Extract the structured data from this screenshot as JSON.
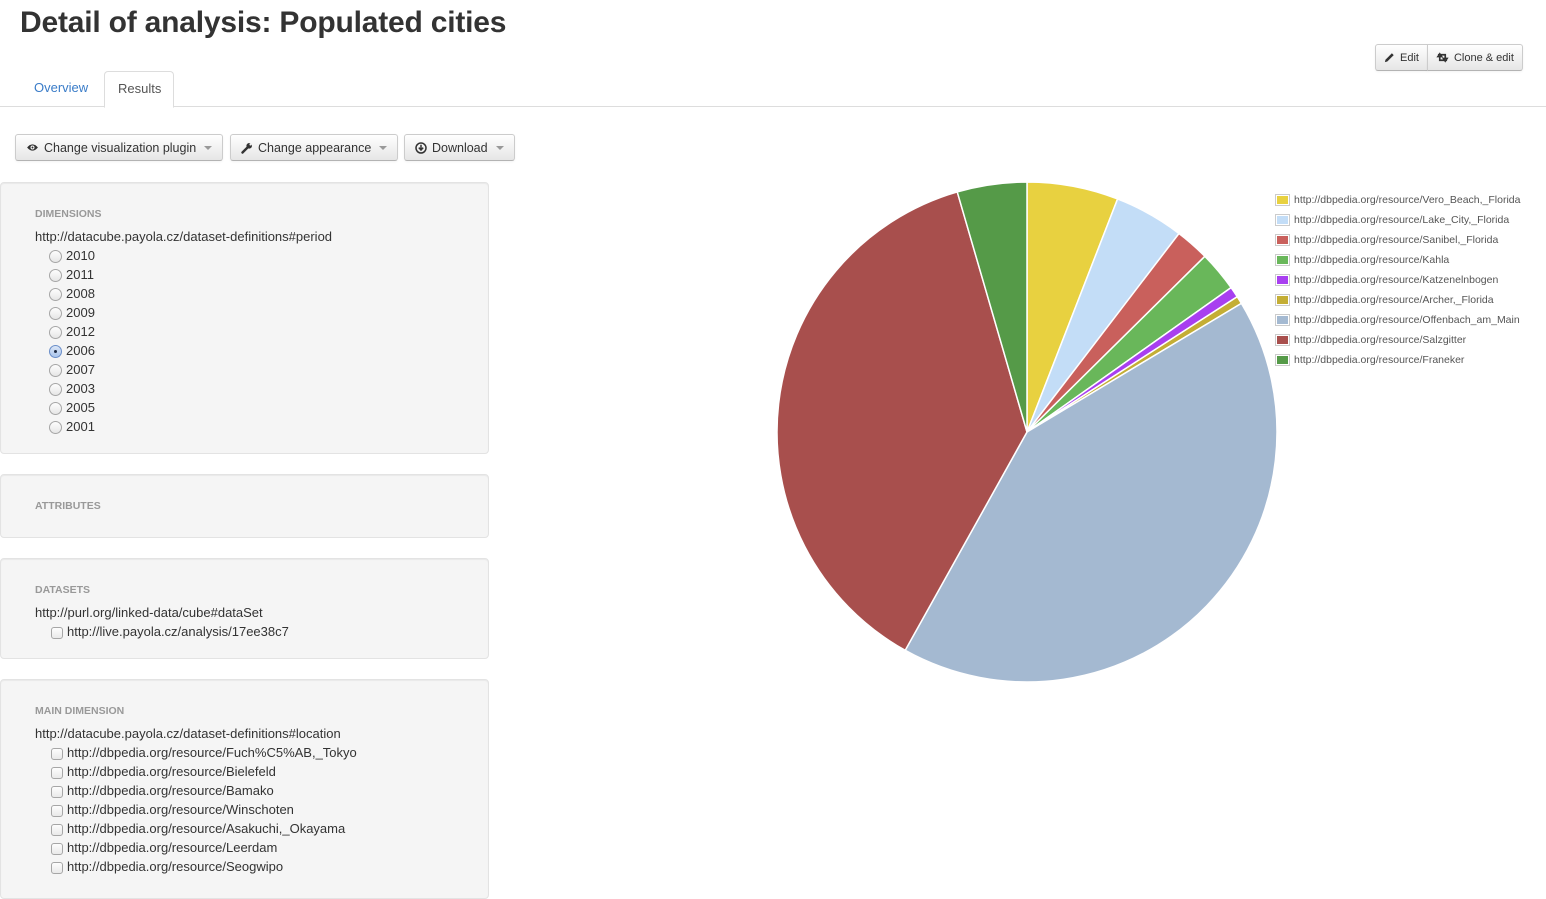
{
  "page": {
    "title": "Detail of analysis: Populated cities"
  },
  "actions": {
    "edit_label": "Edit",
    "clone_label": "Clone & edit"
  },
  "tabs": [
    {
      "label": "Overview",
      "active": false
    },
    {
      "label": "Results",
      "active": true
    }
  ],
  "toolbar": {
    "plugin_label": "Change visualization plugin",
    "appearance_label": "Change appearance",
    "download_label": "Download"
  },
  "dimensions": {
    "heading": "DIMENSIONS",
    "uri": "http://datacube.payola.cz/dataset-definitions#period",
    "options": [
      {
        "label": "2010",
        "checked": false
      },
      {
        "label": "2011",
        "checked": false
      },
      {
        "label": "2008",
        "checked": false
      },
      {
        "label": "2009",
        "checked": false
      },
      {
        "label": "2012",
        "checked": false
      },
      {
        "label": "2006",
        "checked": true
      },
      {
        "label": "2007",
        "checked": false
      },
      {
        "label": "2003",
        "checked": false
      },
      {
        "label": "2005",
        "checked": false
      },
      {
        "label": "2001",
        "checked": false
      }
    ]
  },
  "attributes": {
    "heading": "ATTRIBUTES"
  },
  "datasets": {
    "heading": "DATASETS",
    "uri": "http://purl.org/linked-data/cube#dataSet",
    "options": [
      {
        "label": "http://live.payola.cz/analysis/17ee38c7",
        "checked": false
      }
    ]
  },
  "main_dimension": {
    "heading": "MAIN DIMENSION",
    "uri": "http://datacube.payola.cz/dataset-definitions#location",
    "options": [
      {
        "label": "http://dbpedia.org/resource/Fuch%C5%AB,_Tokyo",
        "checked": false
      },
      {
        "label": "http://dbpedia.org/resource/Bielefeld",
        "checked": false
      },
      {
        "label": "http://dbpedia.org/resource/Bamako",
        "checked": false
      },
      {
        "label": "http://dbpedia.org/resource/Winschoten",
        "checked": false
      },
      {
        "label": "http://dbpedia.org/resource/Asakuchi,_Okayama",
        "checked": false
      },
      {
        "label": "http://dbpedia.org/resource/Leerdam",
        "checked": false
      },
      {
        "label": "http://dbpedia.org/resource/Seogwipo",
        "checked": false
      }
    ]
  },
  "chart_data": {
    "type": "pie",
    "title": "",
    "legend_position": "top-right",
    "unit": "percent",
    "categories": [
      "http://dbpedia.org/resource/Vero_Beach,_Florida",
      "http://dbpedia.org/resource/Lake_City,_Florida",
      "http://dbpedia.org/resource/Sanibel,_Florida",
      "http://dbpedia.org/resource/Kahla",
      "http://dbpedia.org/resource/Katzenelnbogen",
      "http://dbpedia.org/resource/Archer,_Florida",
      "http://dbpedia.org/resource/Offenbach_am_Main",
      "http://dbpedia.org/resource/Salzgitter",
      "http://dbpedia.org/resource/Franeker"
    ],
    "values": [
      5.9,
      4.5,
      2.2,
      2.6,
      0.7,
      0.5,
      41.7,
      37.4,
      4.5
    ],
    "colors": [
      "#e8d140",
      "#c3ddf7",
      "#c9605c",
      "#69b75a",
      "#a83ff0",
      "#c4ae35",
      "#a4b9d1",
      "#a84f4d",
      "#559a48"
    ]
  }
}
